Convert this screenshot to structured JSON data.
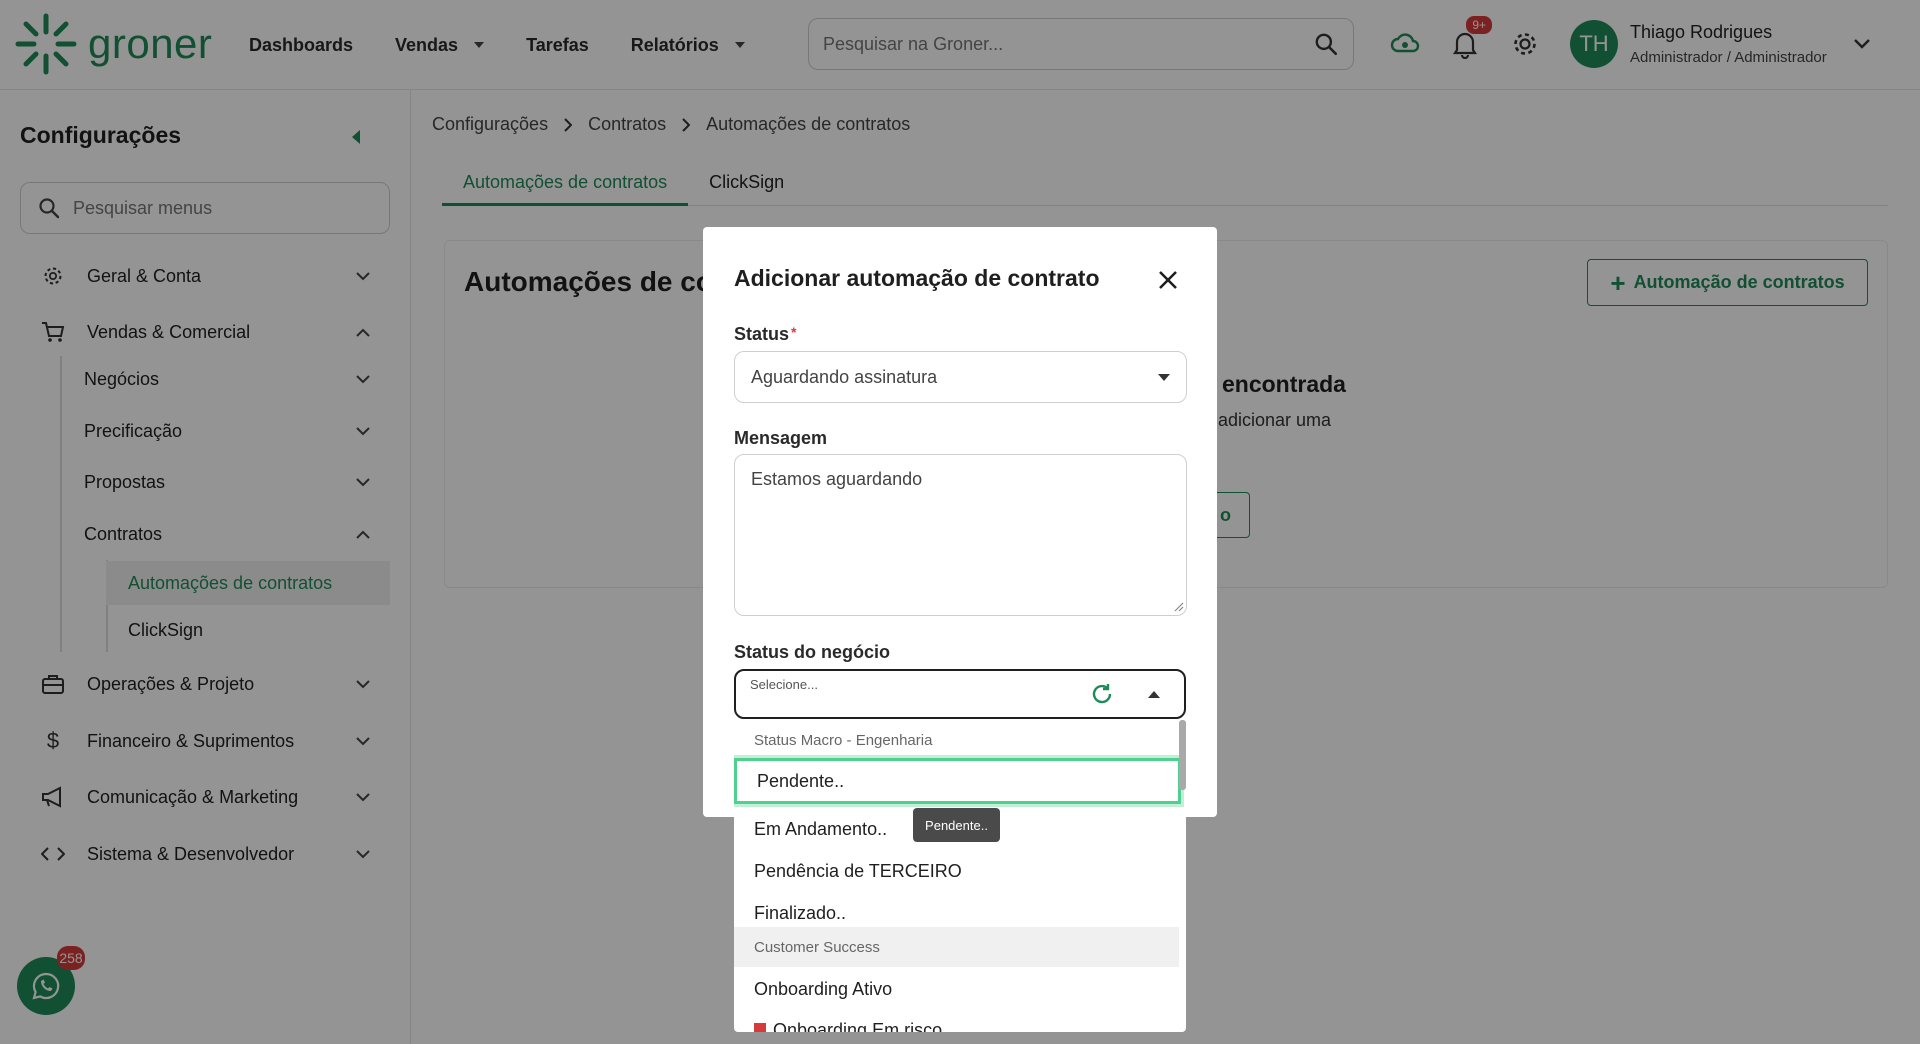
{
  "app": {
    "logo_text": "groner"
  },
  "nav": {
    "items": [
      {
        "label": "Dashboards",
        "has_caret": false
      },
      {
        "label": "Vendas",
        "has_caret": true
      },
      {
        "label": "Tarefas",
        "has_caret": false
      },
      {
        "label": "Relatórios",
        "has_caret": true
      }
    ]
  },
  "top_search": {
    "placeholder": "Pesquisar na Groner..."
  },
  "notifications": {
    "badge": "9+"
  },
  "user": {
    "initials": "TH",
    "name": "Thiago Rodrigues",
    "role": "Administrador / Administrador"
  },
  "sidebar": {
    "title": "Configurações",
    "search_placeholder": "Pesquisar menus",
    "items": [
      {
        "label": "Geral & Conta",
        "icon": "gear-icon"
      },
      {
        "label": "Vendas & Comercial",
        "icon": "cart-icon"
      },
      {
        "label": "Operações & Projeto",
        "icon": "briefcase-icon"
      },
      {
        "label": "Financeiro & Suprimentos",
        "icon": "dollar-icon"
      },
      {
        "label": "Comunicação & Marketing",
        "icon": "megaphone-icon"
      },
      {
        "label": "Sistema & Desenvolvedor",
        "icon": "code-icon"
      }
    ],
    "subitems": [
      {
        "label": "Negócios"
      },
      {
        "label": "Precificação"
      },
      {
        "label": "Propostas"
      },
      {
        "label": "Contratos"
      }
    ],
    "leaves": [
      {
        "label": "Automações de contratos"
      },
      {
        "label": "ClickSign"
      }
    ],
    "whatsapp_badge": "258"
  },
  "breadcrumb": [
    "Configurações",
    "Contratos",
    "Automações de contratos"
  ],
  "tabs": [
    {
      "label": "Automações de contratos"
    },
    {
      "label": "ClickSign"
    }
  ],
  "main": {
    "card_title": "Automações de co",
    "add_button": "Automação de contratos",
    "empty_title": "encontrada",
    "empty_subtitle": "adicionar uma",
    "empty_button": "o"
  },
  "modal": {
    "title": "Adicionar automação de contrato",
    "status_label": "Status",
    "status_required": "*",
    "status_value": "Aguardando assinatura",
    "message_label": "Mensagem",
    "message_value": "Estamos aguardando",
    "deal_status_label": "Status do negócio",
    "deal_status_placeholder": "Selecione..."
  },
  "dropdown": {
    "groups": [
      "Status Macro - Engenharia",
      "Customer Success"
    ],
    "options_group1": [
      "Pendente..",
      "Em Andamento..",
      "Pendência de TERCEIRO",
      "Finalizado.."
    ],
    "options_group2": [
      "Onboarding Ativo",
      "Onboarding Em risco"
    ],
    "tooltip": "Pendente.."
  },
  "colors": {
    "brand": "#1f8a5a",
    "highlight": "#4fd08f",
    "badge": "#d63a3a"
  }
}
